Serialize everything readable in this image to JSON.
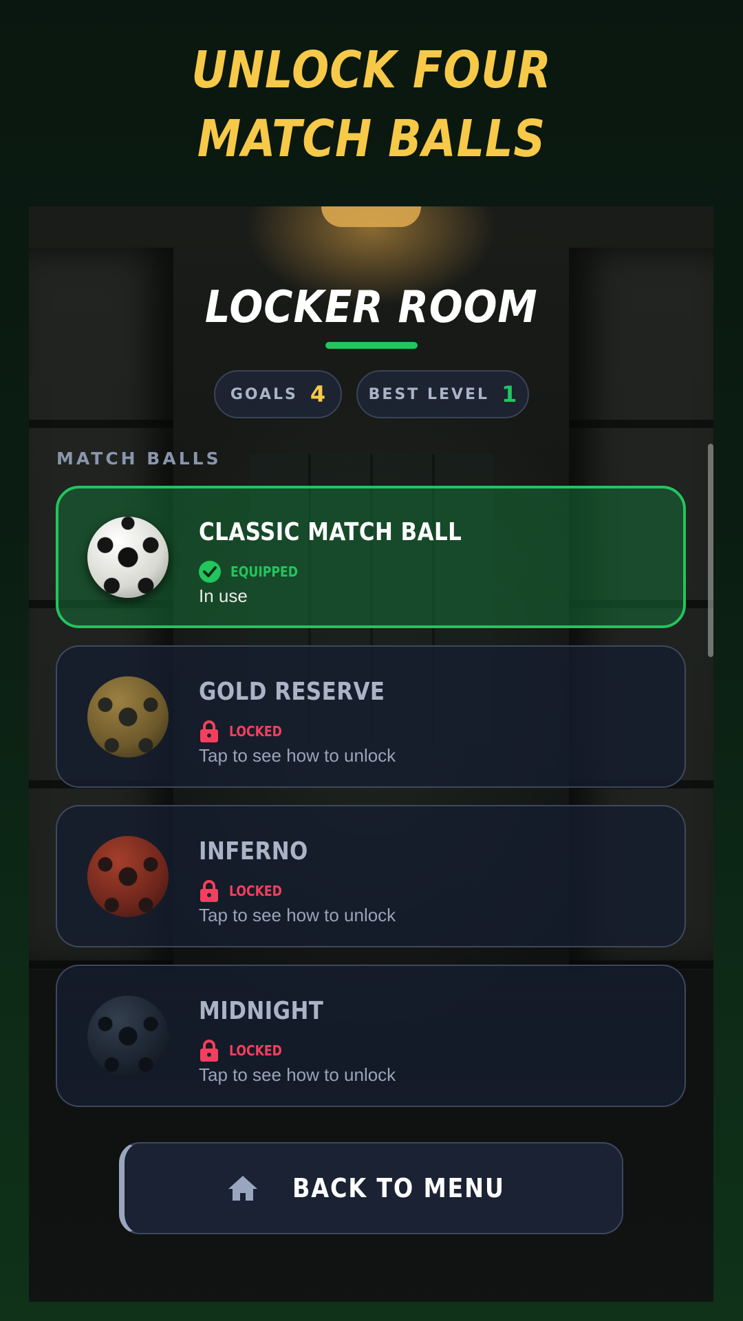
{
  "headline": {
    "line1": "UNLOCK FOUR",
    "line2": "MATCH BALLS"
  },
  "screen": {
    "title": "LOCKER ROOM",
    "stats": {
      "goals_label": "GOALS",
      "goals_value": "4",
      "best_level_label": "BEST LEVEL",
      "best_level_value": "1"
    },
    "section_label": "MATCH BALLS",
    "balls": [
      {
        "name": "CLASSIC MATCH BALL",
        "status": "EQUIPPED",
        "subtext": "In use",
        "icon": "check-circle-icon"
      },
      {
        "name": "GOLD RESERVE",
        "status": "LOCKED",
        "subtext": "Tap to see how to unlock",
        "icon": "lock-icon"
      },
      {
        "name": "INFERNO",
        "status": "LOCKED",
        "subtext": "Tap to see how to unlock",
        "icon": "lock-icon"
      },
      {
        "name": "MIDNIGHT",
        "status": "LOCKED",
        "subtext": "Tap to see how to unlock",
        "icon": "lock-icon"
      }
    ],
    "back_button": {
      "label": "BACK TO MENU",
      "icon": "home-icon"
    }
  },
  "colors": {
    "accent_yellow": "#f7c948",
    "accent_green": "#22c55e",
    "locked_red": "#f43f5e"
  }
}
